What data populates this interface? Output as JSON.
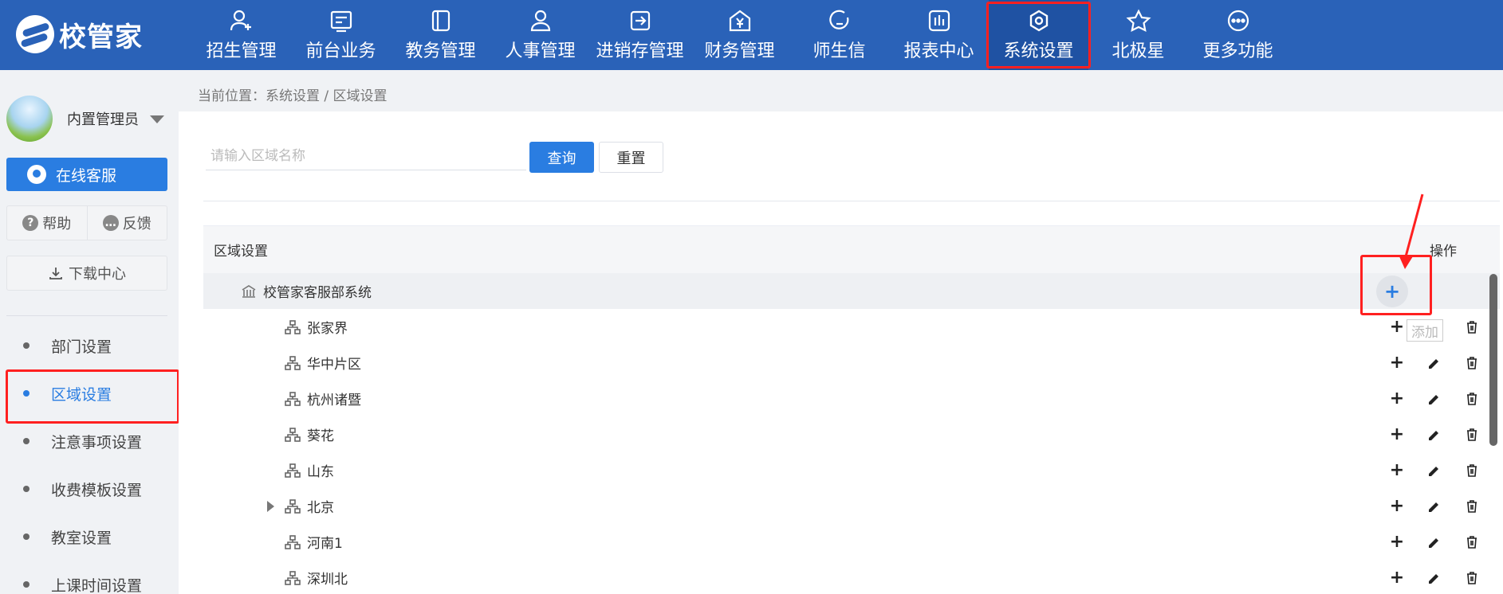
{
  "app": {
    "logo_text": "校管家"
  },
  "nav": [
    {
      "label": "招生管理",
      "icon": "user-plus-icon"
    },
    {
      "label": "前台业务",
      "icon": "reception-icon"
    },
    {
      "label": "教务管理",
      "icon": "book-icon"
    },
    {
      "label": "人事管理",
      "icon": "person-icon"
    },
    {
      "label": "进销存管理",
      "icon": "inventory-icon"
    },
    {
      "label": "财务管理",
      "icon": "finance-icon"
    },
    {
      "label": "师生信",
      "icon": "message-icon"
    },
    {
      "label": "报表中心",
      "icon": "report-icon"
    },
    {
      "label": "系统设置",
      "icon": "settings-icon"
    },
    {
      "label": "北极星",
      "icon": "star-icon"
    },
    {
      "label": "更多功能",
      "icon": "more-icon"
    }
  ],
  "user": {
    "name": "内置管理员"
  },
  "sidebar": {
    "service_label": "在线客服",
    "help_label": "帮助",
    "feedback_label": "反馈",
    "download_label": "下载中心",
    "menu": [
      {
        "label": "部门设置"
      },
      {
        "label": "区域设置"
      },
      {
        "label": "注意事项设置"
      },
      {
        "label": "收费模板设置"
      },
      {
        "label": "教室设置"
      },
      {
        "label": "上课时间设置"
      }
    ]
  },
  "breadcrumb": "当前位置：系统设置 / 区域设置",
  "search": {
    "placeholder": "请输入区域名称",
    "value": "",
    "query_label": "查询",
    "reset_label": "重置"
  },
  "table": {
    "header_name": "区域设置",
    "header_op": "操作",
    "root": "校管家客服部系统",
    "rows": [
      {
        "name": "张家界"
      },
      {
        "name": "华中片区"
      },
      {
        "name": "杭州诸暨"
      },
      {
        "name": "葵花"
      },
      {
        "name": "山东"
      },
      {
        "name": "北京"
      },
      {
        "name": "河南1"
      },
      {
        "name": "深圳北"
      }
    ]
  },
  "tooltip": "添加",
  "colors": {
    "primary": "#2a7de1",
    "topbar": "#2a62b8",
    "highlight": "#ff2020"
  }
}
